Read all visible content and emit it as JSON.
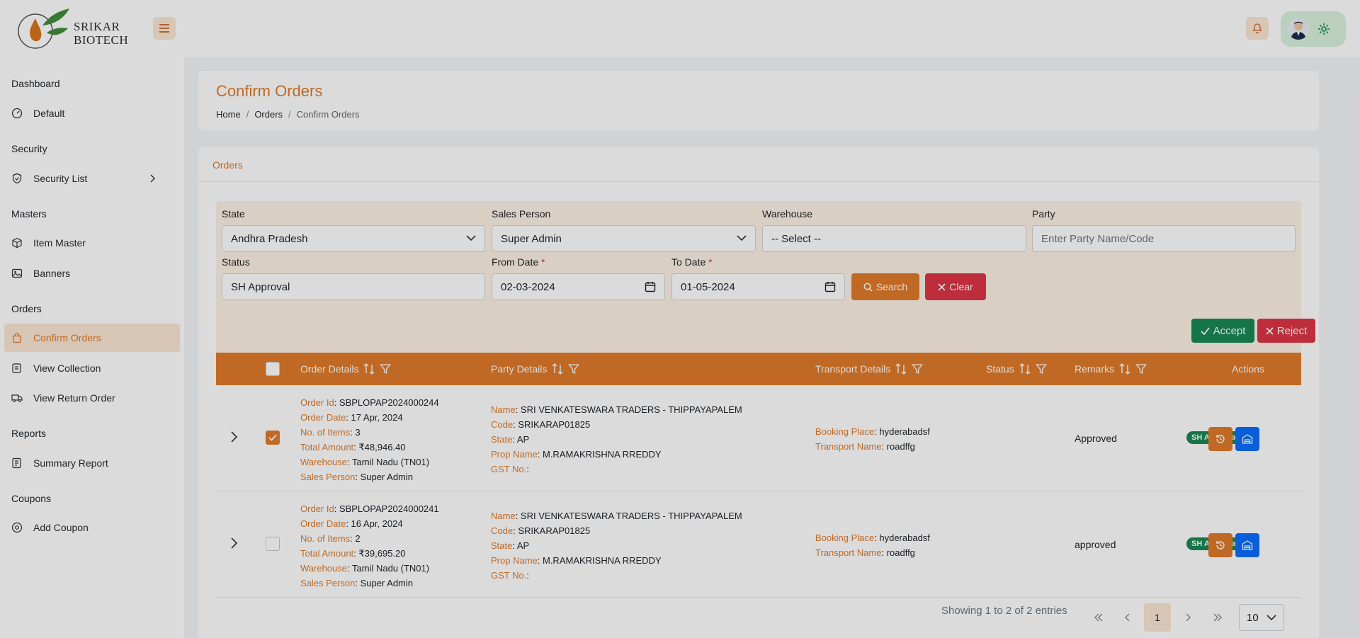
{
  "brand": {
    "line1": "SRIKAR",
    "line2": "BIOTECH"
  },
  "sidebar": {
    "sections": [
      {
        "title": "Dashboard"
      },
      {
        "title": "Security"
      },
      {
        "title": "Masters"
      },
      {
        "title": "Orders"
      },
      {
        "title": "Reports"
      },
      {
        "title": "Coupons"
      }
    ],
    "items": [
      {
        "label": "Default",
        "icon": "dashboard-icon"
      },
      {
        "label": "Security List",
        "icon": "shield-icon"
      },
      {
        "label": "Item Master",
        "icon": "box-icon"
      },
      {
        "label": "Banners",
        "icon": "image-icon"
      },
      {
        "label": "Confirm Orders",
        "icon": "bag-icon",
        "active": true
      },
      {
        "label": "View Collection",
        "icon": "collection-icon"
      },
      {
        "label": "View Return Order",
        "icon": "truck-icon"
      },
      {
        "label": "Summary Report",
        "icon": "report-icon"
      },
      {
        "label": "Add Coupon",
        "icon": "coupon-icon"
      }
    ]
  },
  "page": {
    "title": "Confirm Orders",
    "breadcrumb": [
      "Home",
      "Orders",
      "Confirm Orders"
    ]
  },
  "card": {
    "title": "Orders"
  },
  "filters": {
    "state": {
      "label": "State",
      "value": "Andhra Pradesh"
    },
    "sales_person": {
      "label": "Sales Person",
      "value": "Super Admin"
    },
    "warehouse": {
      "label": "Warehouse",
      "value": "-- Select --"
    },
    "party": {
      "label": "Party",
      "placeholder": "Enter Party Name/Code"
    },
    "status": {
      "label": "Status",
      "value": "SH Approval"
    },
    "from_date": {
      "label": "From Date",
      "required": "*",
      "value": "02-03-2024"
    },
    "to_date": {
      "label": "To Date",
      "required": "*",
      "value": "01-05-2024"
    },
    "search_label": "Search",
    "clear_label": "Clear"
  },
  "actions": {
    "accept_label": "Accept",
    "reject_label": "Reject"
  },
  "table": {
    "headers": {
      "order_details": "Order Details",
      "party_details": "Party Details",
      "transport_details": "Transport Details",
      "status": "Status",
      "remarks": "Remarks",
      "actions": "Actions"
    },
    "field_labels": {
      "order_id": "Order Id",
      "order_date": "Order Date",
      "no_items": "No. of Items",
      "total_amount": "Total Amount",
      "warehouse": "Warehouse",
      "sales_person": "Sales Person",
      "name": "Name",
      "code": "Code",
      "state": "State",
      "prop_name": "Prop Name",
      "gst": "GST No.",
      "booking_place": "Booking Place",
      "transport_name": "Transport Name"
    },
    "rows": [
      {
        "checked": true,
        "order_id": "SBPLOPAP2024000244",
        "order_date": "17 Apr, 2024",
        "no_items": "3",
        "total_amount": "₹48,946.40",
        "warehouse": "Tamil Nadu (TN01)",
        "sales_person": "Super Admin",
        "name": "SRI VENKATESWARA TRADERS - THIPPAYAPALEM",
        "code": "SRIKARAP01825",
        "state": "AP",
        "prop_name": "M.RAMAKRISHNA RREDDY",
        "gst": "",
        "booking_place": "hyderabadsf",
        "transport_name": "roadffg",
        "status": "SH Approval",
        "remarks": "Approved"
      },
      {
        "checked": false,
        "order_id": "SBPLOPAP2024000241",
        "order_date": "16 Apr, 2024",
        "no_items": "2",
        "total_amount": "₹39,695.20",
        "warehouse": "Tamil Nadu (TN01)",
        "sales_person": "Super Admin",
        "name": "SRI VENKATESWARA TRADERS - THIPPAYAPALEM",
        "code": "SRIKARAP01825",
        "state": "AP",
        "prop_name": "M.RAMAKRISHNA RREDDY",
        "gst": "",
        "booking_place": "hyderabadsf",
        "transport_name": "roadffg",
        "status": "SH Approval",
        "remarks": "approved"
      }
    ]
  },
  "pagination": {
    "summary": "Showing 1 to 2 of 2 entries",
    "current_page": "1",
    "page_size": "10"
  },
  "colors": {
    "accent": "#e07b2a",
    "success": "#198754",
    "danger": "#dc3545",
    "primary": "#0d6efd"
  }
}
